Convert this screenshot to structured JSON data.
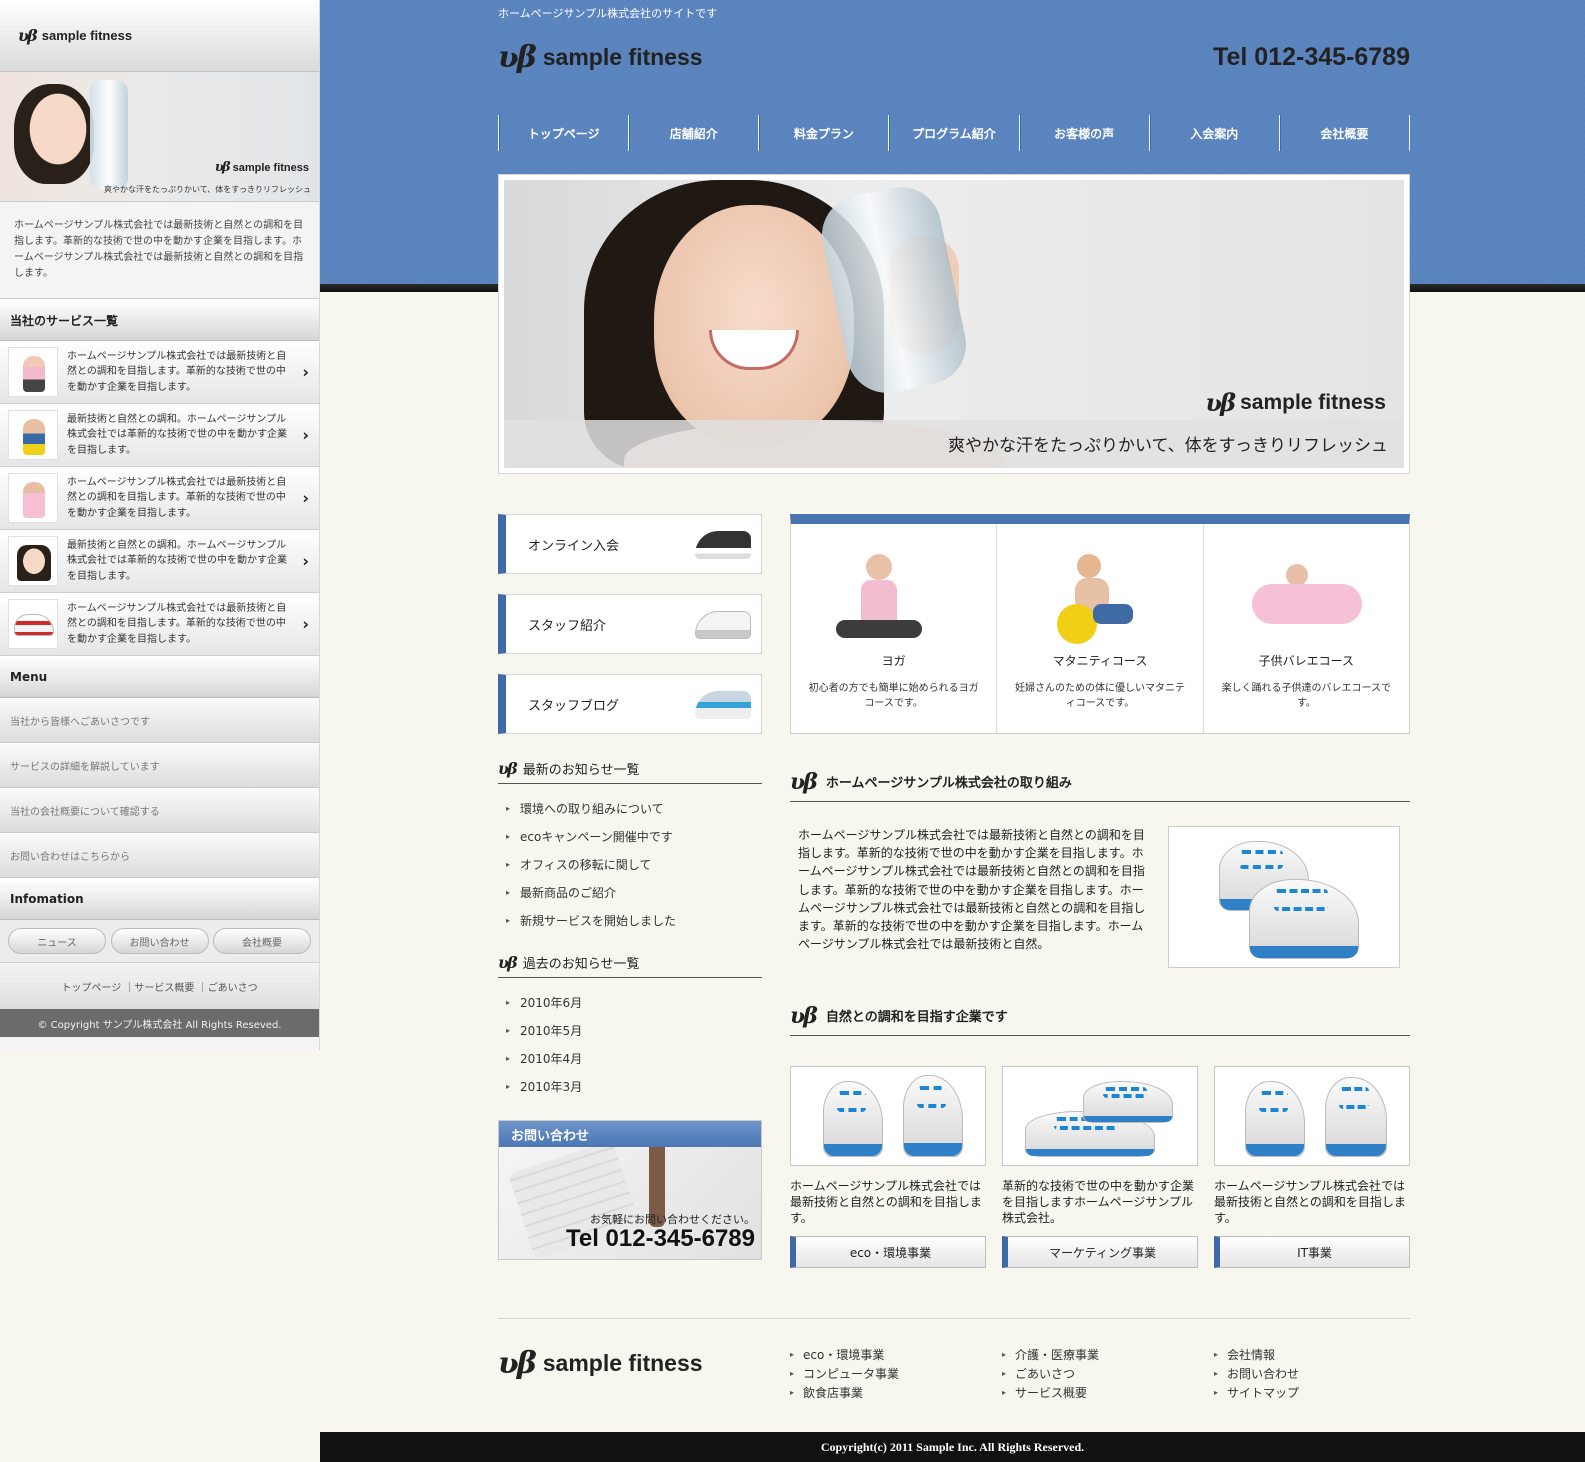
{
  "sidebar": {
    "logo_text": "sample fitness",
    "banner_logo": "sample fitness",
    "banner_caption": "爽やかな汗をたっぷりかいて、体をすっきりリフレッシュ",
    "intro": "ホームページサンプル株式会社では最新技術と自然との調和を目指します。革新的な技術で世の中を動かす企業を目指します。ホームページサンプル株式会社では最新技術と自然との調和を目指します。",
    "services_title": "当社のサービス一覧",
    "services": [
      {
        "text": "ホームページサンプル株式会社では最新技術と自然との調和を目指します。革新的な技術で世の中を動かす企業を目指します。",
        "thumb": "yoga-woman"
      },
      {
        "text": "最新技術と自然との調和。ホームページサンプル株式会社では革新的な技術で世の中を動かす企業を目指します。",
        "thumb": "maternity-ball"
      },
      {
        "text": "ホームページサンプル株式会社では最新技術と自然との調和を目指します。革新的な技術で世の中を動かす企業を目指します。",
        "thumb": "ballet-girl"
      },
      {
        "text": "最新技術と自然との調和。ホームページサンプル株式会社では革新的な技術で世の中を動かす企業を目指します。",
        "thumb": "smiling-woman"
      },
      {
        "text": "ホームページサンプル株式会社では最新技術と自然との調和を目指します。革新的な技術で世の中を動かす企業を目指します。",
        "thumb": "red-lace-sneakers"
      }
    ],
    "menu_title": "Menu",
    "menu": [
      "当社から皆様へごあいさつです",
      "サービスの詳細を解説しています",
      "当社の会社概要について確認する",
      "お問い合わせはこちらから"
    ],
    "info_title": "Infomation",
    "info_buttons": [
      "ニュース",
      "お問い合わせ",
      "会社概要"
    ],
    "footer_links": "トップページ ｜サービス概要 ｜ごあいさつ",
    "copyright": "© Copyright サンプル株式会社 All Rights Reseved."
  },
  "header": {
    "tagline": "ホームページサンプル株式会社のサイトです",
    "logo_text": "sample fitness",
    "tel": "Tel 012-345-6789",
    "nav": [
      "トップページ",
      "店舗紹介",
      "料金プラン",
      "プログラム紹介",
      "お客様の声",
      "入会案内",
      "会社概要"
    ]
  },
  "hero": {
    "logo_text": "sample fitness",
    "caption": "爽やかな汗をたっぷりかいて、体をすっきりリフレッシュ"
  },
  "left": {
    "buttons": [
      "オンライン入会",
      "スタッフ紹介",
      "スタッフブログ"
    ],
    "news_title": "最新のお知らせ一覧",
    "news": [
      "環境への取り組みについて",
      "ecoキャンペーン開催中です",
      "オフィスの移転に関して",
      "最新商品のご紹介",
      "新規サービスを開始しました"
    ],
    "past_title": "過去のお知らせ一覧",
    "past": [
      "2010年6月",
      "2010年5月",
      "2010年4月",
      "2010年3月"
    ],
    "contact_title": "お問い合わせ",
    "contact_note": "お気軽にお問い合わせください。",
    "contact_tel": "Tel 012-345-6789"
  },
  "courses": [
    {
      "name": "ヨガ",
      "desc": "初心者の方でも簡単に始められるヨガコースです。"
    },
    {
      "name": "マタニティコース",
      "desc": "妊婦さんのための体に優しいマタニティコースです。"
    },
    {
      "name": "子供バレエコース",
      "desc": "楽しく踊れる子供達のバレエコースです。"
    }
  ],
  "about": {
    "title": "ホームページサンプル株式会社の取り組み",
    "text": "ホームページサンプル株式会社では最新技術と自然との調和を目指します。革新的な技術で世の中を動かす企業を目指します。ホームページサンプル株式会社では最新技術と自然との調和を目指します。革新的な技術で世の中を動かす企業を目指します。ホームページサンプル株式会社では最新技術と自然との調和を目指します。革新的な技術で世の中を動かす企業を目指します。ホームページサンプル株式会社では最新技術と自然。"
  },
  "business": {
    "title": "自然との調和を目指す企業です",
    "items": [
      {
        "text": "ホームページサンプル株式会社では最新技術と自然との調和を目指します。",
        "button": "eco・環境事業"
      },
      {
        "text": "革新的な技術で世の中を動かす企業を目指しますホームページサンプル株式会社。",
        "button": "マーケティング事業"
      },
      {
        "text": "ホームページサンプル株式会社では最新技術と自然との調和を目指します。",
        "button": "IT事業"
      }
    ]
  },
  "footer": {
    "logo_text": "sample fitness",
    "col1": [
      "eco・環境事業",
      "コンピュータ事業",
      "飲食店事業"
    ],
    "col2": [
      "介護・医療事業",
      "ごあいさつ",
      "サービス概要"
    ],
    "col3": [
      "会社情報",
      "お問い合わせ",
      "サイトマップ"
    ],
    "copyright": "Copyright(c) 2011 Sample Inc. All Rights Reserved."
  },
  "colors": {
    "header_blue": "#5a83bd",
    "accent_blue": "#3e6aa8",
    "lace_blue": "#1c86d6",
    "page_bg": "#f7f6ef"
  }
}
